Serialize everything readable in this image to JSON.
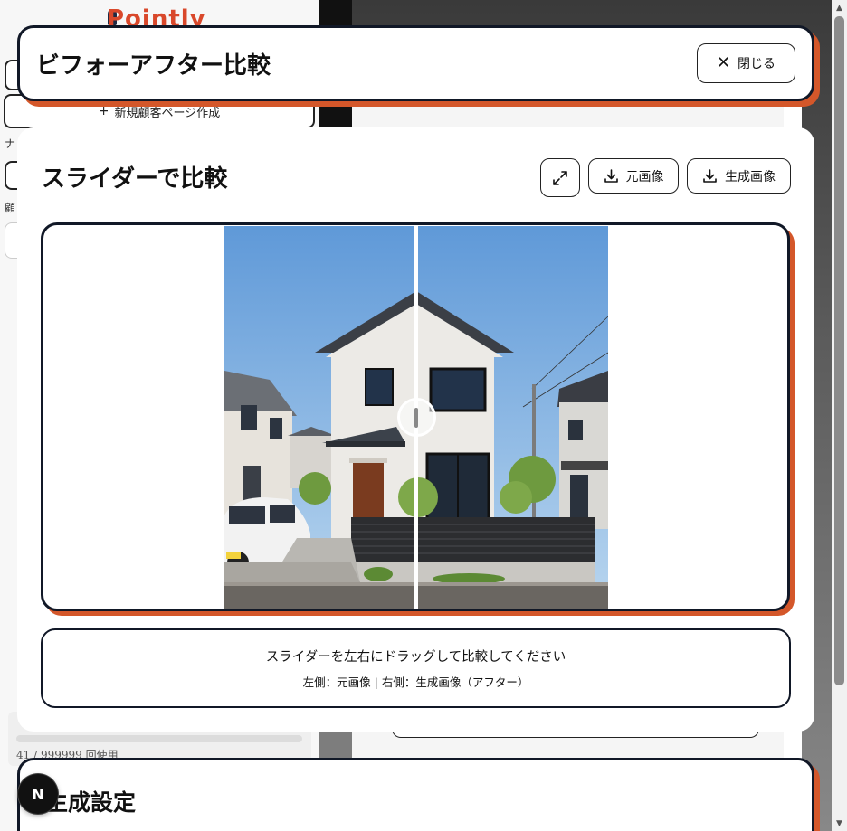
{
  "background": {
    "logo": "Pointly",
    "new_page_label": "新規顧客ページ作成",
    "new_page_icon": "plus-icon",
    "label_na": "ナ",
    "label_kao": "顧",
    "usage_text": "41 / 999999 回使用"
  },
  "header": {
    "title": "ビフォーアフター比較",
    "close_label": "閉じる",
    "close_icon": "close-icon"
  },
  "compare": {
    "title": "スライダーで比較",
    "expand_icon": "expand-icon",
    "download_original_label": "元画像",
    "download_generated_label": "生成画像",
    "download_icon": "download-icon",
    "slider_position_percent": 50,
    "hint_main": "スライダーを左右にドラッグして比較してください",
    "hint_sub": "左側：元画像 | 右側：生成画像（アフター）"
  },
  "settings": {
    "title": "生成設定"
  },
  "badge": {
    "letter": "N"
  },
  "colors": {
    "accent": "#d4572a",
    "frame": "#111827"
  }
}
